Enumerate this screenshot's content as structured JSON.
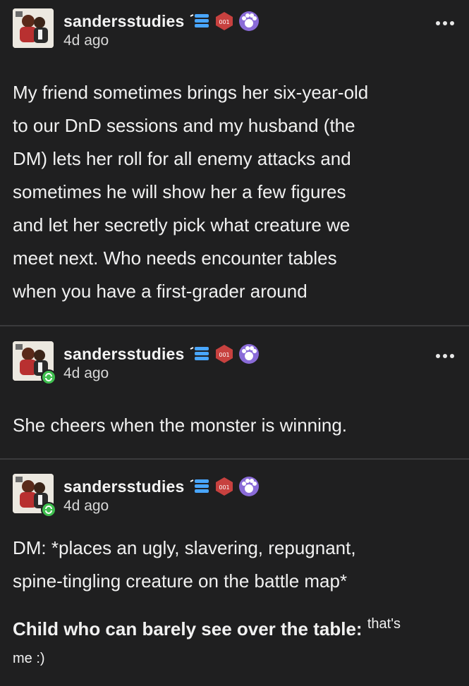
{
  "colors": {
    "background": "#1f1f20",
    "text": "#f1f1f1",
    "muted": "#d8d8d8",
    "reblog_badge": "#3fbf4f",
    "badge_blue": "#49a6ff",
    "badge_red": "#c7413f",
    "badge_purple": "#8a6bd8"
  },
  "icons": {
    "avatar": "avatar-icon",
    "stack_badge": "stack-badge-icon",
    "hex_badge": "hex-badge-icon",
    "paw_badge": "paw-badge-icon",
    "reblog": "reblog-icon",
    "more": "more-options-icon"
  },
  "posts": [
    {
      "username": "sandersstudies",
      "hex_badge_label": "001",
      "timestamp": "4d ago",
      "lines": [
        "My friend sometimes brings her six-year-old",
        "to our DnD sessions and my husband (the",
        "DM) lets her roll for all enemy attacks and",
        "sometimes he will show her a few figures",
        "and let her secretly pick what creature we",
        "meet next. Who needs encounter tables",
        "when you have a first-grader around"
      ]
    },
    {
      "username": "sandersstudies",
      "hex_badge_label": "001",
      "timestamp": "4d ago",
      "lines": [
        "She cheers when the monster is winning."
      ]
    },
    {
      "username": "sandersstudies",
      "hex_badge_label": "001",
      "timestamp": "4d ago",
      "lines": [
        "DM: *places an ugly, slavering, repugnant,",
        "spine-tingling creature on the battle map*"
      ],
      "bold_line": "Child who can barely see over the table:",
      "small_text_1": "that's",
      "small_text_2": "me :)"
    }
  ]
}
